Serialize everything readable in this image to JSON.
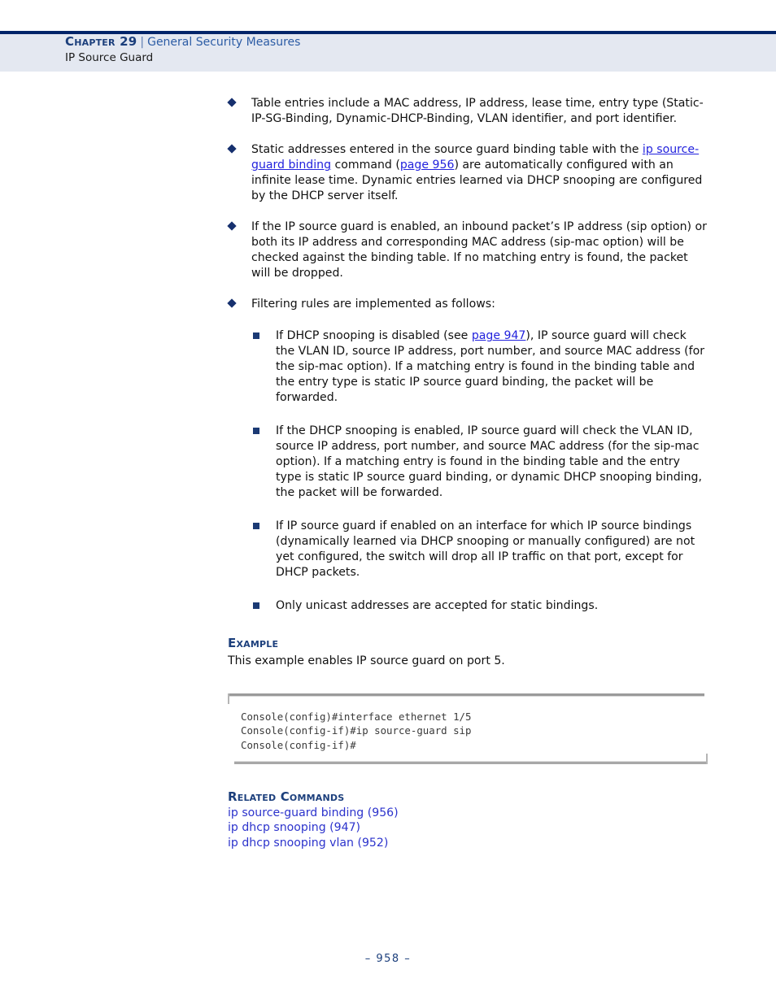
{
  "header": {
    "chapter_label": "Chapter 29",
    "separator": "|",
    "section_title": "General Security Measures",
    "subsection_title": "IP Source Guard",
    "band_color": "#e4e8f1",
    "rule_color": "#002469"
  },
  "bullets": [
    {
      "marker": "diamond",
      "text": "Table entries include a MAC address, IP address, lease time, entry type (Static-IP-SG-Binding, Dynamic-DHCP-Binding, VLAN identifier, and port identifier."
    },
    {
      "marker": "diamond",
      "segments": [
        {
          "text": "Static addresses entered in the source guard binding table with the ",
          "link": false
        },
        {
          "text": "ip source-guard binding",
          "link": true
        },
        {
          "text": " command (",
          "link": false
        },
        {
          "text": "page 956",
          "link": true
        },
        {
          "text": ") are automatically configured with an infinite lease time. Dynamic entries learned via DHCP snooping are configured by the DHCP server itself.",
          "link": false
        }
      ]
    },
    {
      "marker": "diamond",
      "text": "If the IP source guard is enabled, an inbound packet’s IP address (sip option) or both its IP address and corresponding MAC address (sip-mac option) will be checked against the binding table. If no matching entry is found, the packet will be dropped."
    },
    {
      "marker": "diamond",
      "text": "Filtering rules are implemented as follows:"
    }
  ],
  "sub_bullets": [
    {
      "marker": "square",
      "segments": [
        {
          "text": "If DHCP snooping is disabled (see ",
          "link": false
        },
        {
          "text": "page 947",
          "link": true
        },
        {
          "text": "), IP source guard will check the VLAN ID, source IP address, port number, and source MAC address (for the sip-mac option). If a matching entry is found in the binding table and the entry type is static IP source guard binding, the packet will be forwarded.",
          "link": false
        }
      ]
    },
    {
      "marker": "square",
      "text": "If the DHCP snooping is enabled, IP source guard will check the VLAN ID, source IP address, port number, and source MAC address (for the sip-mac option). If a matching entry is found in the binding table and the entry type is static IP source guard binding, or dynamic DHCP snooping binding, the packet will be forwarded."
    },
    {
      "marker": "square",
      "text": "If IP source guard if enabled on an interface for which IP source bindings (dynamically learned via DHCP snooping or manually configured) are not yet configured, the switch will drop all IP traffic on that port, except for DHCP packets."
    },
    {
      "marker": "square",
      "text": "Only unicast addresses are accepted for static bindings."
    }
  ],
  "example": {
    "heading": "Example",
    "description": "This example enables IP source guard on port 5.",
    "code": "Console(config)#interface ethernet 1/5\nConsole(config-if)#ip source-guard sip\nConsole(config-if)#"
  },
  "related": {
    "heading": "Related Commands",
    "links": [
      "ip source-guard binding (956)",
      "ip dhcp snooping (947)",
      "ip dhcp snooping vlan (952)"
    ],
    "link_color": "#2c33cc"
  },
  "footer": {
    "page_number": "–  958  –"
  }
}
